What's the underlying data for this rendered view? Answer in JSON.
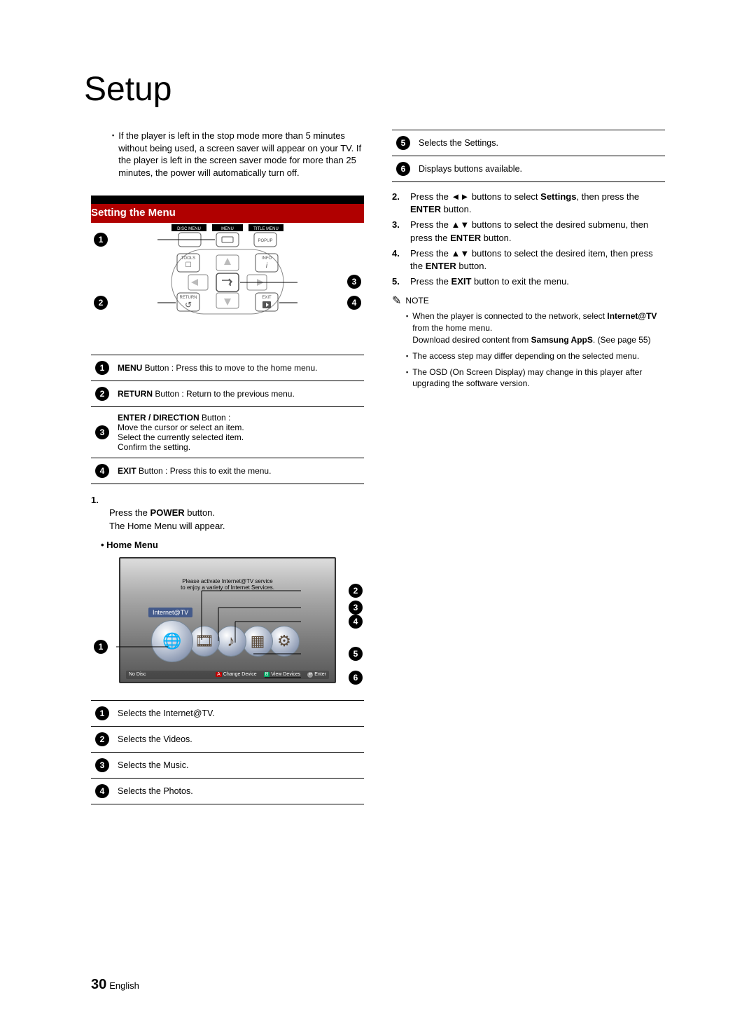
{
  "page_title": "Setup",
  "top_note": "If the player is left in the stop mode more than 5 minutes without being used, a screen saver will appear on your TV. If the player is left in the screen saver mode for more than 25 minutes, the power will automatically turn off.",
  "section_bar": "Setting the Menu",
  "remote_labels": {
    "disc_menu": "DISC MENU",
    "menu": "MENU",
    "title_menu": "TITLE MENU",
    "popup": "POPUP",
    "tools": "TOOLS",
    "info": "INFO",
    "return": "RETURN",
    "exit": "EXIT"
  },
  "remote_legend": [
    {
      "num": "1",
      "bold": "MENU",
      "rest": " Button : Press this to move to the home menu."
    },
    {
      "num": "2",
      "bold": "RETURN",
      "rest": " Button : Return to the previous menu."
    },
    {
      "num": "3",
      "bold": "ENTER / DIRECTION",
      "rest": " Button :\nMove the cursor or select an item.\nSelect the currently selected item.\nConfirm the setting."
    },
    {
      "num": "4",
      "bold": "EXIT",
      "rest": " Button : Press this to exit the menu."
    }
  ],
  "step1_pre": "Press the ",
  "step1_bold": "POWER",
  "step1_post": " button.\nThe Home Menu will appear.",
  "home_menu_label": "• Home Menu",
  "home_menu": {
    "message_l1": "Please activate Internet@TV service",
    "message_l2": "to enjoy a variety of Internet Services.",
    "tag": "Internet@TV",
    "bottom_no_disc": "No Disc",
    "bottom_change": "Change Device",
    "bottom_view": "View Devices",
    "bottom_enter": "Enter",
    "key_a": "A",
    "key_b": "B"
  },
  "home_legend": [
    {
      "num": "1",
      "text": "Selects the Internet@TV."
    },
    {
      "num": "2",
      "text": "Selects the Videos."
    },
    {
      "num": "3",
      "text": "Selects the Music."
    },
    {
      "num": "4",
      "text": "Selects the Photos."
    }
  ],
  "home_legend_right": [
    {
      "num": "5",
      "text": "Selects the Settings."
    },
    {
      "num": "6",
      "text": "Displays buttons available."
    }
  ],
  "steps_right": [
    {
      "n": "2.",
      "pre": "Press the ◄► buttons to select ",
      "b1": "Settings",
      "mid": ", then press the ",
      "b2": "ENTER",
      "post": " button."
    },
    {
      "n": "3.",
      "pre": "Press the ▲▼ buttons to select the desired submenu, then press the ",
      "b1": "ENTER",
      "mid": "",
      "b2": "",
      "post": " button."
    },
    {
      "n": "4.",
      "pre": "Press the ▲▼ buttons to select the desired item, then press the ",
      "b1": "ENTER",
      "mid": "",
      "b2": "",
      "post": " button."
    },
    {
      "n": "5.",
      "pre": "Press the ",
      "b1": "EXIT",
      "mid": "",
      "b2": "",
      "post": " button to exit the menu."
    }
  ],
  "note_label": "NOTE",
  "notes": [
    {
      "pre": "When the player is connected to the network, select ",
      "b1": "Internet@TV",
      "mid": " from the home menu.\nDownload desired content from ",
      "b2": "Samsung AppS",
      "post": ". (See page 55)"
    },
    {
      "pre": "The access step may differ depending on the selected menu.",
      "b1": "",
      "mid": "",
      "b2": "",
      "post": ""
    },
    {
      "pre": "The OSD (On Screen Display) may change in this player after upgrading the software version.",
      "b1": "",
      "mid": "",
      "b2": "",
      "post": ""
    }
  ],
  "footer": {
    "page": "30",
    "lang": "English"
  }
}
